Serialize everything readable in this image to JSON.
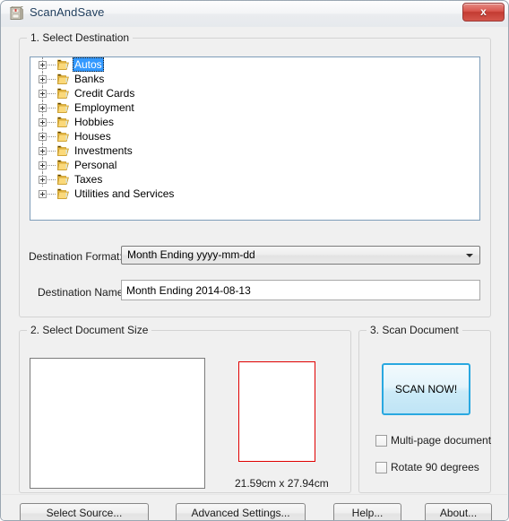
{
  "window": {
    "title": "ScanAndSave",
    "icon": "file-cabinet-icon",
    "close_label": "x"
  },
  "groups": {
    "destination": {
      "title": "1. Select Destination"
    },
    "document_size": {
      "title": "2. Select Document Size"
    },
    "scan_document": {
      "title": "3. Scan Document"
    }
  },
  "tree": {
    "selected": "Autos",
    "items": [
      {
        "label": "Autos",
        "selected": true,
        "expander": "plus",
        "icon": "folder-icon"
      },
      {
        "label": "Banks",
        "selected": false,
        "expander": "plus",
        "icon": "folder-icon"
      },
      {
        "label": "Credit Cards",
        "selected": false,
        "expander": "plus",
        "icon": "folder-icon"
      },
      {
        "label": "Employment",
        "selected": false,
        "expander": "plus",
        "icon": "folder-icon"
      },
      {
        "label": "Hobbies",
        "selected": false,
        "expander": "plus",
        "icon": "folder-icon"
      },
      {
        "label": "Houses",
        "selected": false,
        "expander": "plus",
        "icon": "folder-icon"
      },
      {
        "label": "Investments",
        "selected": false,
        "expander": "plus",
        "icon": "folder-icon"
      },
      {
        "label": "Personal",
        "selected": false,
        "expander": "plus",
        "icon": "folder-icon"
      },
      {
        "label": "Taxes",
        "selected": false,
        "expander": "plus",
        "icon": "folder-icon"
      },
      {
        "label": "Utilities and Services",
        "selected": false,
        "expander": "plus",
        "icon": "folder-icon"
      }
    ]
  },
  "destination_format": {
    "label": "Destination Format:",
    "value": "Month Ending yyyy-mm-dd",
    "options": [
      "Month Ending yyyy-mm-dd"
    ],
    "arrow_icon": "chevron-down-icon"
  },
  "destination_name": {
    "label": "Destination Name:",
    "value": "Month Ending 2014-08-13",
    "placeholder": ""
  },
  "document_size": {
    "dimensions_text": "21.59cm x 27.94cm",
    "page_outline_color": "#e00000",
    "preview_background": "#ffffff"
  },
  "scan": {
    "button_label": "SCAN NOW!",
    "button_border_color": "#29a8e0",
    "checkboxes": [
      {
        "label": "Multi-page document",
        "checked": false
      },
      {
        "label": "Rotate 90 degrees",
        "checked": false
      }
    ]
  },
  "buttons": {
    "select_source": "Select Source...",
    "advanced_settings": "Advanced Settings...",
    "help": "Help...",
    "about": "About..."
  },
  "colors": {
    "dialog_background": "#f0f0f0",
    "selection_blue": "#3399ff",
    "title_text": "#1e3d5c",
    "close_red": "#c33b32"
  }
}
